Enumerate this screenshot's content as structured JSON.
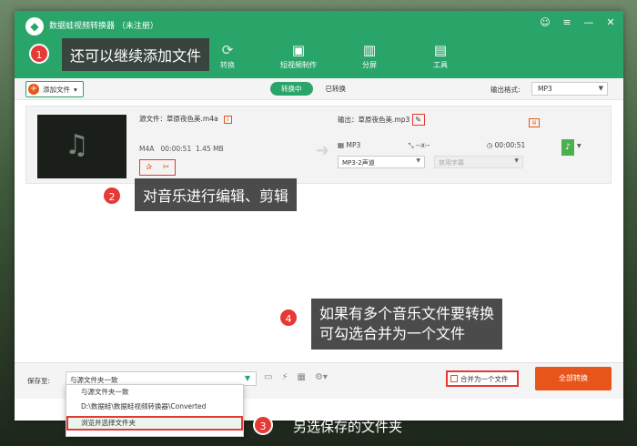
{
  "app": {
    "title": "数据蛙视频转换器 （未注册）",
    "window_buttons": [
      "☺",
      "≡",
      "—",
      "✕"
    ],
    "tabs": [
      {
        "label": "转换",
        "icon": "convert-icon"
      },
      {
        "label": "短视频制作",
        "icon": "image-icon"
      },
      {
        "label": "分屏",
        "icon": "split-icon"
      },
      {
        "label": "工具",
        "icon": "toolbox-icon"
      }
    ]
  },
  "toolbar": {
    "add_file": "添加文件",
    "seg_on": "转换中",
    "seg_off": "已转换",
    "format_label": "输出格式:",
    "format_value": "MP3"
  },
  "file": {
    "source": "源文件：草原夜色美.m4a",
    "format": "M4A",
    "duration": "00:00:51",
    "size": "1.45 MB",
    "output": "输出：草原夜色美.mp3",
    "out_format": "MP3",
    "out_resolution": "--x--",
    "out_duration": "00:00:51",
    "channel": "MP3-2声道",
    "subtitle": "禁用字幕"
  },
  "bottom": {
    "save_to_label": "保存至:",
    "save_to_value": "与源文件夹一致",
    "merge_label": "合并为一个文件",
    "convert_all": "全部转换"
  },
  "dropdown": {
    "items": [
      "与源文件夹一致",
      "D:\\数据蛙\\数据蛙视频转换器\\Converted",
      "浏览并选择文件夹"
    ]
  },
  "callouts": {
    "c1": "还可以继续添加文件",
    "c2": "对音乐进行编辑、剪辑",
    "c4_line1": "如果有多个音乐文件要转换",
    "c4_line2": "可勾选合并为一个文件",
    "c3": "另选保存的文件夹",
    "n1": "1",
    "n2": "2",
    "n3": "3",
    "n4": "4"
  },
  "colors": {
    "brand_green": "#2aa56a",
    "accent_orange": "#e8551b",
    "highlight_red": "#e53935"
  }
}
